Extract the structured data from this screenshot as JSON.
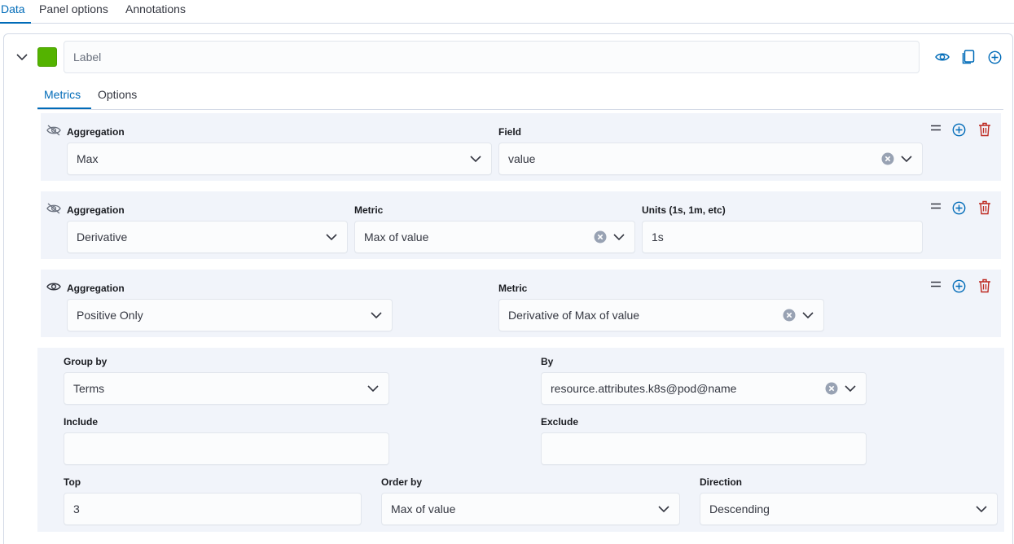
{
  "tabs": {
    "data": "Data",
    "panel_options": "Panel options",
    "annotations": "Annotations"
  },
  "series": {
    "color": "#54b300",
    "label_placeholder": "Label",
    "label_value": ""
  },
  "subtabs": {
    "metrics": "Metrics",
    "options": "Options"
  },
  "metrics": [
    {
      "visibility_icon": "eye-closed-icon",
      "aggregation_label": "Aggregation",
      "aggregation_value": "Max",
      "field_label": "Field",
      "field_value": "value"
    },
    {
      "visibility_icon": "eye-closed-icon",
      "aggregation_label": "Aggregation",
      "aggregation_value": "Derivative",
      "metric_label": "Metric",
      "metric_value": "Max of value",
      "units_label": "Units (1s, 1m, etc)",
      "units_value": "1s"
    },
    {
      "visibility_icon": "eye-icon",
      "aggregation_label": "Aggregation",
      "aggregation_value": "Positive Only",
      "metric_label": "Metric",
      "metric_value": "Derivative of Max of value"
    }
  ],
  "group": {
    "group_by_label": "Group by",
    "group_by_value": "Terms",
    "by_label": "By",
    "by_value": "resource.attributes.k8s@pod@name",
    "include_label": "Include",
    "include_value": "",
    "exclude_label": "Exclude",
    "exclude_value": "",
    "top_label": "Top",
    "top_value": "3",
    "order_by_label": "Order by",
    "order_by_value": "Max of value",
    "direction_label": "Direction",
    "direction_value": "Descending"
  },
  "colors": {
    "accent": "#006bb8",
    "delete": "#bd271e",
    "panel_bg": "#f1f4fa",
    "border": "#d3dae6"
  }
}
